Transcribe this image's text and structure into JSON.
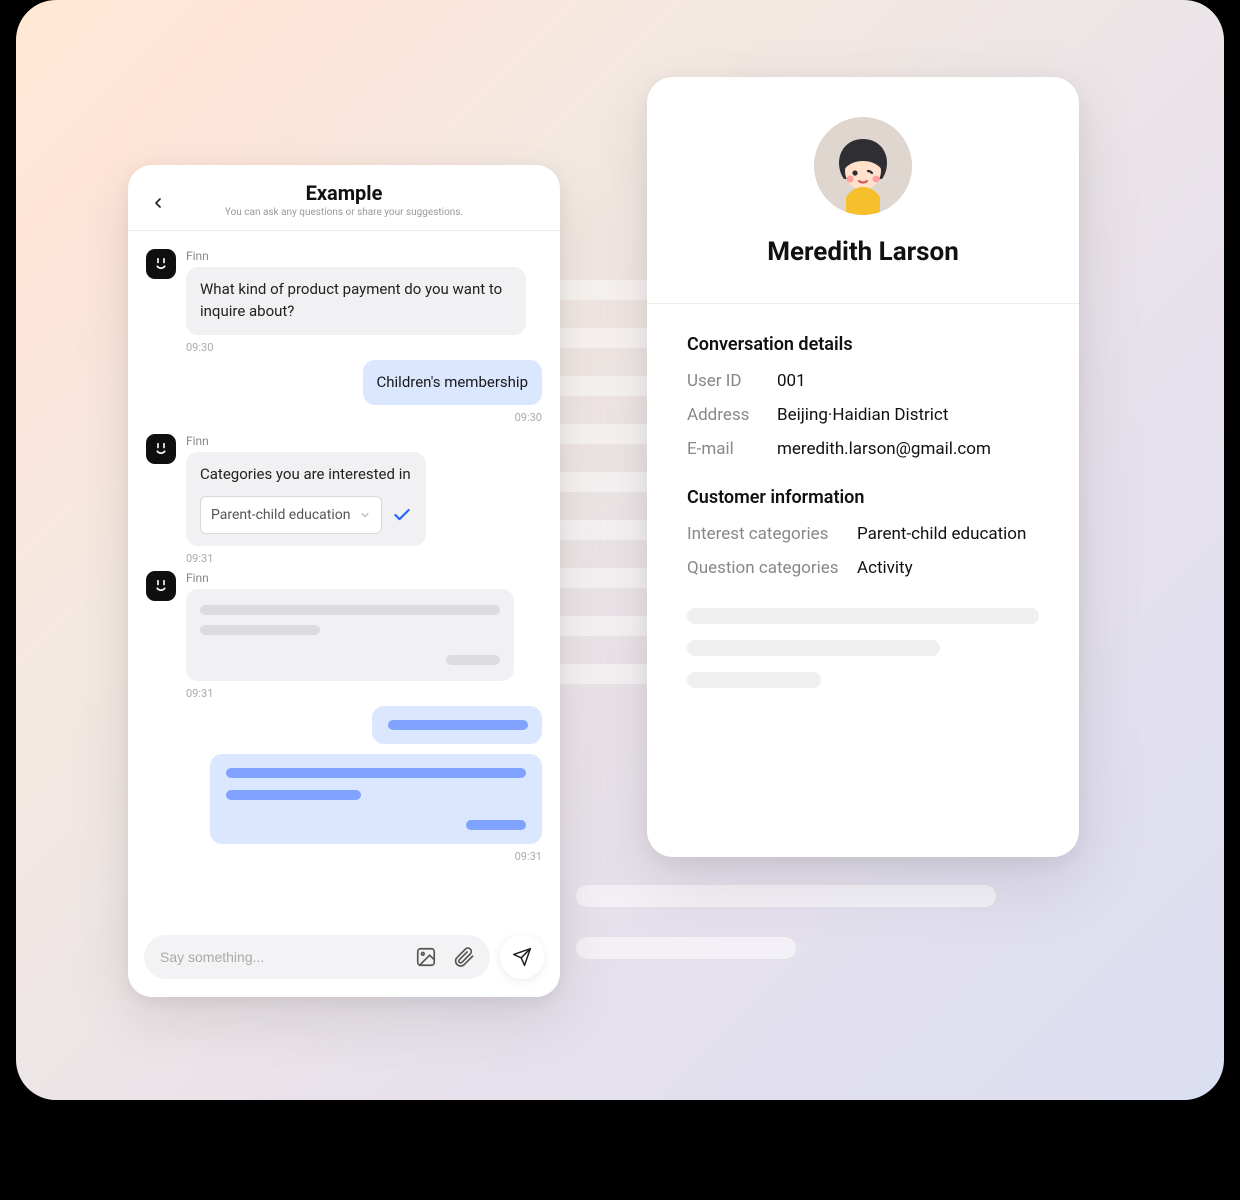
{
  "chat": {
    "title": "Example",
    "subtitle": "You can ask any questions or share your suggestions.",
    "bot_name": "Finn",
    "messages": {
      "m1": {
        "text": "What kind of product payment do you want to inquire about?",
        "time": "09:30"
      },
      "m2": {
        "text": "Children's membership",
        "time": "09:30"
      },
      "m3": {
        "text": "Categories you are interested in",
        "time": "09:31",
        "select_value": "Parent-child education"
      },
      "m4": {
        "time": "09:31"
      },
      "m5": {
        "time": "09:31"
      }
    },
    "input_placeholder": "Say something..."
  },
  "profile": {
    "name": "Meredith Larson",
    "conversation_section": "Conversation details",
    "user_id_label": "User ID",
    "user_id": "001",
    "address_label": "Address",
    "address": "Beijing·Haidian District",
    "email_label": "E-mail",
    "email": "meredith.larson@gmail.com",
    "customer_section": "Customer information",
    "interest_label": "Interest categories",
    "interest_value": "Parent-child education",
    "question_label": "Question categories",
    "question_value": "Activity"
  }
}
